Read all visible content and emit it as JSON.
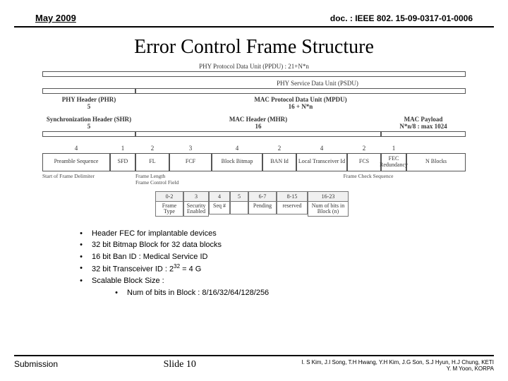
{
  "header": {
    "date": "May 2009",
    "docref": "doc. : IEEE 802. 15-09-0317-01-0006"
  },
  "title": "Error Control Frame Structure",
  "diagram": {
    "ppdu": {
      "caption": "PHY Protocol Data Unit (PPDU) : 21+N*n"
    },
    "psdu": {
      "caption": "PHY Service Data Unit (PSDU)"
    },
    "phr": {
      "label": "PHY Header (PHR)",
      "width": "5"
    },
    "mpdu": {
      "label": "MAC Protocol Data Unit (MPDU)",
      "width": "16 + N*n"
    },
    "shr": {
      "label": "Synchronization Header (SHR)",
      "width": "5"
    },
    "mhr": {
      "label": "MAC Header (MHR)",
      "width": "16"
    },
    "payload": {
      "label": "MAC Payload",
      "width": "N*n/8 : max 1024"
    },
    "field_widths": {
      "preamble": "4",
      "sfd": "1",
      "fl": "2",
      "fcf": "3",
      "bitmap": "4",
      "ban": "2",
      "xcvr": "4",
      "fcs": "2",
      "red": "1",
      "blocks": ""
    },
    "fields": {
      "preamble": "Preamble Sequence",
      "sfd": "SFD",
      "fl": "FL",
      "fcf": "FCF",
      "bitmap": "Block Bitmap",
      "ban": "BAN Id",
      "xcvr": "Local Transceiver Id",
      "fcs": "FCS",
      "red": "FEC Redundancy",
      "blocks": "N Blocks"
    },
    "notes": {
      "sfd": "Start of Frame Delimiter",
      "fl": "Frame Length",
      "fcf": "Frame Control Field",
      "fcs": "Frame Check Sequence"
    },
    "fcf_table": {
      "headers": {
        "bits": "0-2",
        "seq1": "3",
        "seq2": "4",
        "seq3": "5",
        "pending": "6-7",
        "reserved": "8-15",
        "nbits": "16-23"
      },
      "cells": {
        "bits": "Frame Type",
        "seq1": "Security Enabled",
        "seq2": "Seq #",
        "seq3": "",
        "pending": "Pending",
        "reserved": "reserved",
        "nbits": "Num of bits in Block (n)"
      }
    }
  },
  "bullets": {
    "b1": "Header FEC for implantable devices",
    "b2": "32 bit Bitmap Block for 32 data blocks",
    "b3": "16 bit Ban ID : Medical Service ID",
    "b4_a": "32 bit Transceiver ID : 2",
    "b4_b": "32",
    "b4_c": " = 4 G",
    "b5": "Scalable Block Size :",
    "b5s": "Num of bits in Block : 8/16/32/64/128/256"
  },
  "footer": {
    "left": "Submission",
    "center": "Slide 10",
    "right1": "I. S Kim, J.I Song, T.H Hwang, Y.H Kim, J.G Son, S.J Hyun, H.J Chung, KETI",
    "right2": "Y. M Yoon, KORPA"
  }
}
